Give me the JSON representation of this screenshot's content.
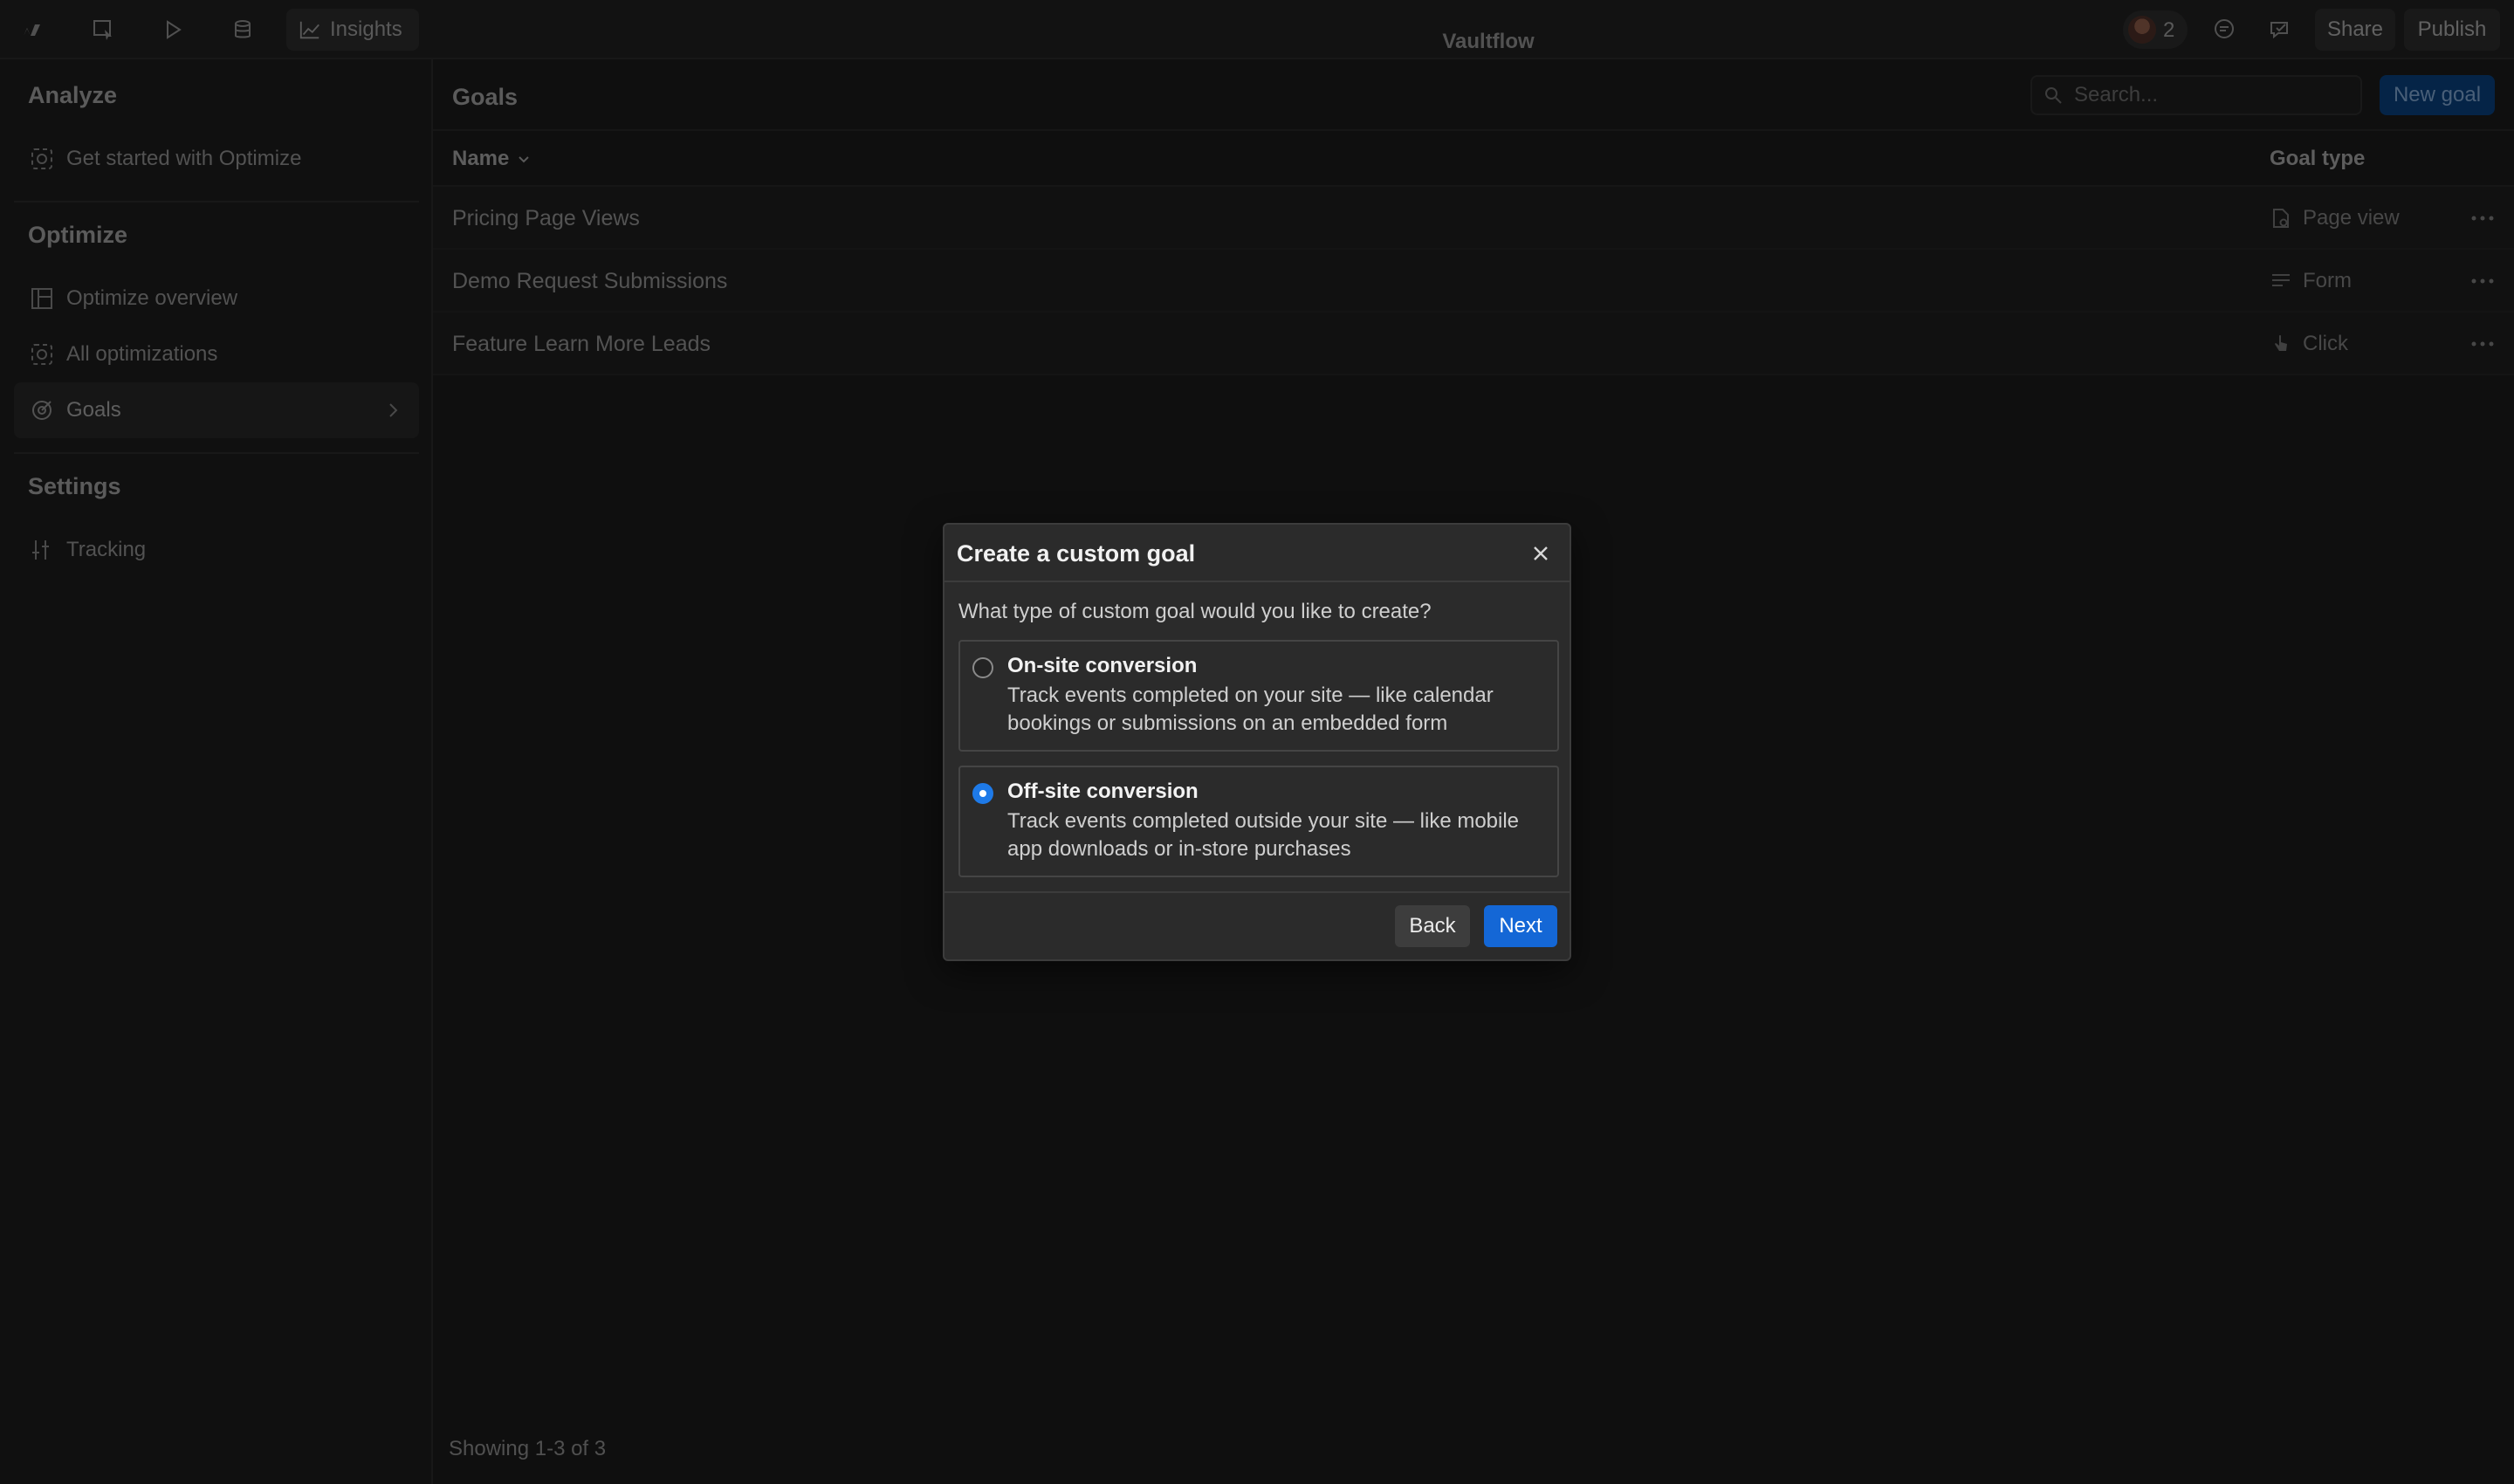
{
  "app": {
    "title": "Vaultflow"
  },
  "topbar": {
    "tabs": [
      {
        "icon": "webflow-logo-icon"
      },
      {
        "icon": "cursor-select-icon"
      },
      {
        "icon": "play-icon"
      },
      {
        "icon": "database-icon"
      }
    ],
    "active_tab_label": "Insights",
    "collaborator_count": "2",
    "share_label": "Share",
    "publish_label": "Publish"
  },
  "sidebar": {
    "analyze_heading": "Analyze",
    "analyze_items": [
      {
        "label": "Get started with Optimize",
        "icon": "target-icon"
      }
    ],
    "optimize_heading": "Optimize",
    "optimize_items": [
      {
        "label": "Optimize overview",
        "icon": "layout-icon"
      },
      {
        "label": "All optimizations",
        "icon": "target-icon"
      },
      {
        "label": "Goals",
        "icon": "goal-icon",
        "active": true
      }
    ],
    "settings_heading": "Settings",
    "settings_items": [
      {
        "label": "Tracking",
        "icon": "sliders-icon"
      }
    ]
  },
  "main": {
    "title": "Goals",
    "search_placeholder": "Search...",
    "new_goal_label": "New goal",
    "columns": {
      "name": "Name",
      "goal_type": "Goal type"
    },
    "rows": [
      {
        "name": "Pricing Page Views",
        "type": "Page view",
        "icon": "page-view-icon"
      },
      {
        "name": "Demo Request Submissions",
        "type": "Form",
        "icon": "form-icon"
      },
      {
        "name": "Feature Learn More Leads",
        "type": "Click",
        "icon": "click-icon"
      }
    ],
    "footer": "Showing 1-3 of 3"
  },
  "modal": {
    "title": "Create a custom goal",
    "question": "What type of custom goal would you like to create?",
    "options": [
      {
        "title": "On-site conversion",
        "description": "Track events completed on your site — like calendar bookings or submissions on an embedded form",
        "selected": false
      },
      {
        "title": "Off-site conversion",
        "description": "Track events completed outside your site — like mobile app downloads or in-store purchases",
        "selected": true
      }
    ],
    "back_label": "Back",
    "next_label": "Next"
  },
  "colors": {
    "accent": "#1467d6",
    "background": "#1b1b1b",
    "modal_bg": "#2b2b2b"
  }
}
